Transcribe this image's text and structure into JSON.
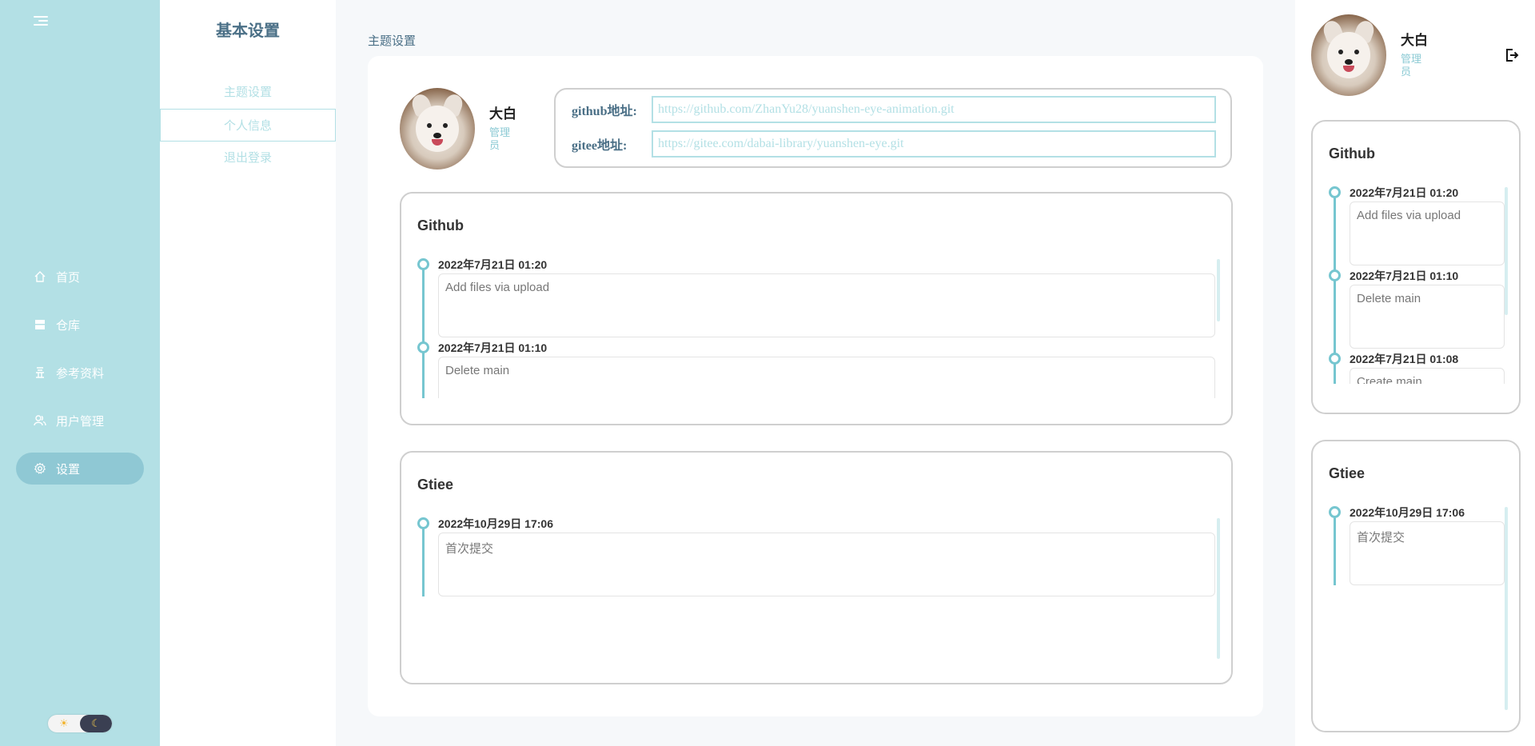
{
  "nav": {
    "items": [
      {
        "label": "首页",
        "icon": "home-icon"
      },
      {
        "label": "仓库",
        "icon": "repository-icon"
      },
      {
        "label": "参考资料",
        "icon": "reference-icon"
      },
      {
        "label": "用户管理",
        "icon": "users-icon"
      },
      {
        "label": "设置",
        "icon": "gear-icon",
        "active": true
      }
    ],
    "theme": {
      "light": "☀",
      "dark": "☾"
    }
  },
  "settings_menu": {
    "title": "基本设置",
    "items": [
      "主题设置",
      "个人信息",
      "退出登录"
    ],
    "active_index": 1
  },
  "breadcrumb": "主题设置",
  "profile": {
    "name": "大白",
    "role": "管理员"
  },
  "links": {
    "github_label": "github地址:",
    "github_value": "https://github.com/ZhanYu28/yuanshen-eye-animation.git",
    "gitee_label": "gitee地址:",
    "gitee_value": "https://gitee.com/dabai-library/yuanshen-eye.git"
  },
  "main_github": {
    "title": "Github",
    "commits": [
      {
        "time": "2022年7月21日  01:20",
        "message": "Add files via upload"
      },
      {
        "time": "2022年7月21日  01:10",
        "message": "Delete main"
      }
    ]
  },
  "main_gitee": {
    "title": "Gtiee",
    "commits": [
      {
        "time": "2022年10月29日  17:06",
        "message": "首次提交"
      }
    ]
  },
  "right_panel": {
    "github": {
      "title": "Github",
      "commits": [
        {
          "time": "2022年7月21日  01:20",
          "message": "Add files via upload"
        },
        {
          "time": "2022年7月21日  01:10",
          "message": "Delete main"
        },
        {
          "time": "2022年7月21日  01:08",
          "message": "Create main"
        }
      ]
    },
    "gitee": {
      "title": "Gtiee",
      "commits": [
        {
          "time": "2022年10月29日  17:06",
          "message": "首次提交"
        }
      ]
    }
  },
  "colors": {
    "accent": "#b3e0e5",
    "accent_dark": "#76c6d0",
    "active_nav": "#8fc8d4",
    "heading": "#4a6f86"
  }
}
